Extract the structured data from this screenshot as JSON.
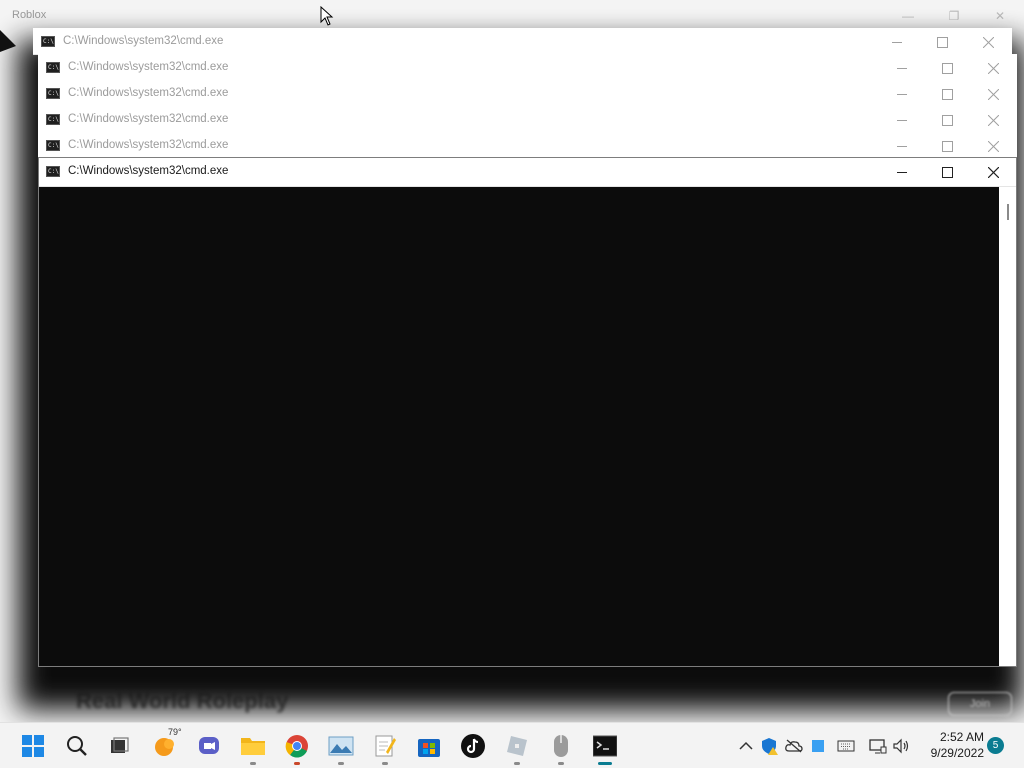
{
  "background_window": {
    "title": "Roblox",
    "game_title": "Real World Roleplay",
    "join_label": "Join"
  },
  "cmd_windows": [
    {
      "title": "C:\\Windows\\system32\\cmd.exe",
      "active": false
    },
    {
      "title": "C:\\Windows\\system32\\cmd.exe",
      "active": false
    },
    {
      "title": "C:\\Windows\\system32\\cmd.exe",
      "active": false
    },
    {
      "title": "C:\\Windows\\system32\\cmd.exe",
      "active": false
    },
    {
      "title": "C:\\Windows\\system32\\cmd.exe",
      "active": false
    },
    {
      "title": "C:\\Windows\\system32\\cmd.exe",
      "active": true
    }
  ],
  "window_controls": {
    "minimize": "minimize-icon",
    "maximize": "maximize-icon",
    "close": "close-icon"
  },
  "taskbar": {
    "items": [
      {
        "name": "start-button",
        "icon": "windows-logo-icon"
      },
      {
        "name": "search-button",
        "icon": "search-icon"
      },
      {
        "name": "task-view-button",
        "icon": "task-view-icon"
      },
      {
        "name": "weather-widget",
        "icon": "weather-sun-icon"
      },
      {
        "name": "teams-chat",
        "icon": "chat-camera-icon"
      },
      {
        "name": "file-explorer",
        "icon": "folder-icon"
      },
      {
        "name": "chrome",
        "icon": "chrome-icon"
      },
      {
        "name": "photos",
        "icon": "photos-icon"
      },
      {
        "name": "notepad",
        "icon": "notepad-icon"
      },
      {
        "name": "microsoft-store",
        "icon": "store-icon"
      },
      {
        "name": "tiktok",
        "icon": "tiktok-icon"
      },
      {
        "name": "roblox",
        "icon": "roblox-icon"
      },
      {
        "name": "mouse-app",
        "icon": "mouse-icon"
      },
      {
        "name": "command-prompt",
        "icon": "terminal-icon"
      }
    ],
    "weather_temp": "79°",
    "tray": [
      "chevron-up-icon",
      "shield-warning-icon",
      "onedrive-offline-icon",
      "blue-square-icon",
      "keyboard-icon",
      "network-icon",
      "volume-icon"
    ],
    "clock_time": "2:52 AM",
    "clock_date": "9/29/2022",
    "notification_count": "5"
  },
  "colors": {
    "accent": "#0a7c91",
    "console_bg": "#0c0c0c",
    "taskbar_bg": "#f3f3f3"
  }
}
